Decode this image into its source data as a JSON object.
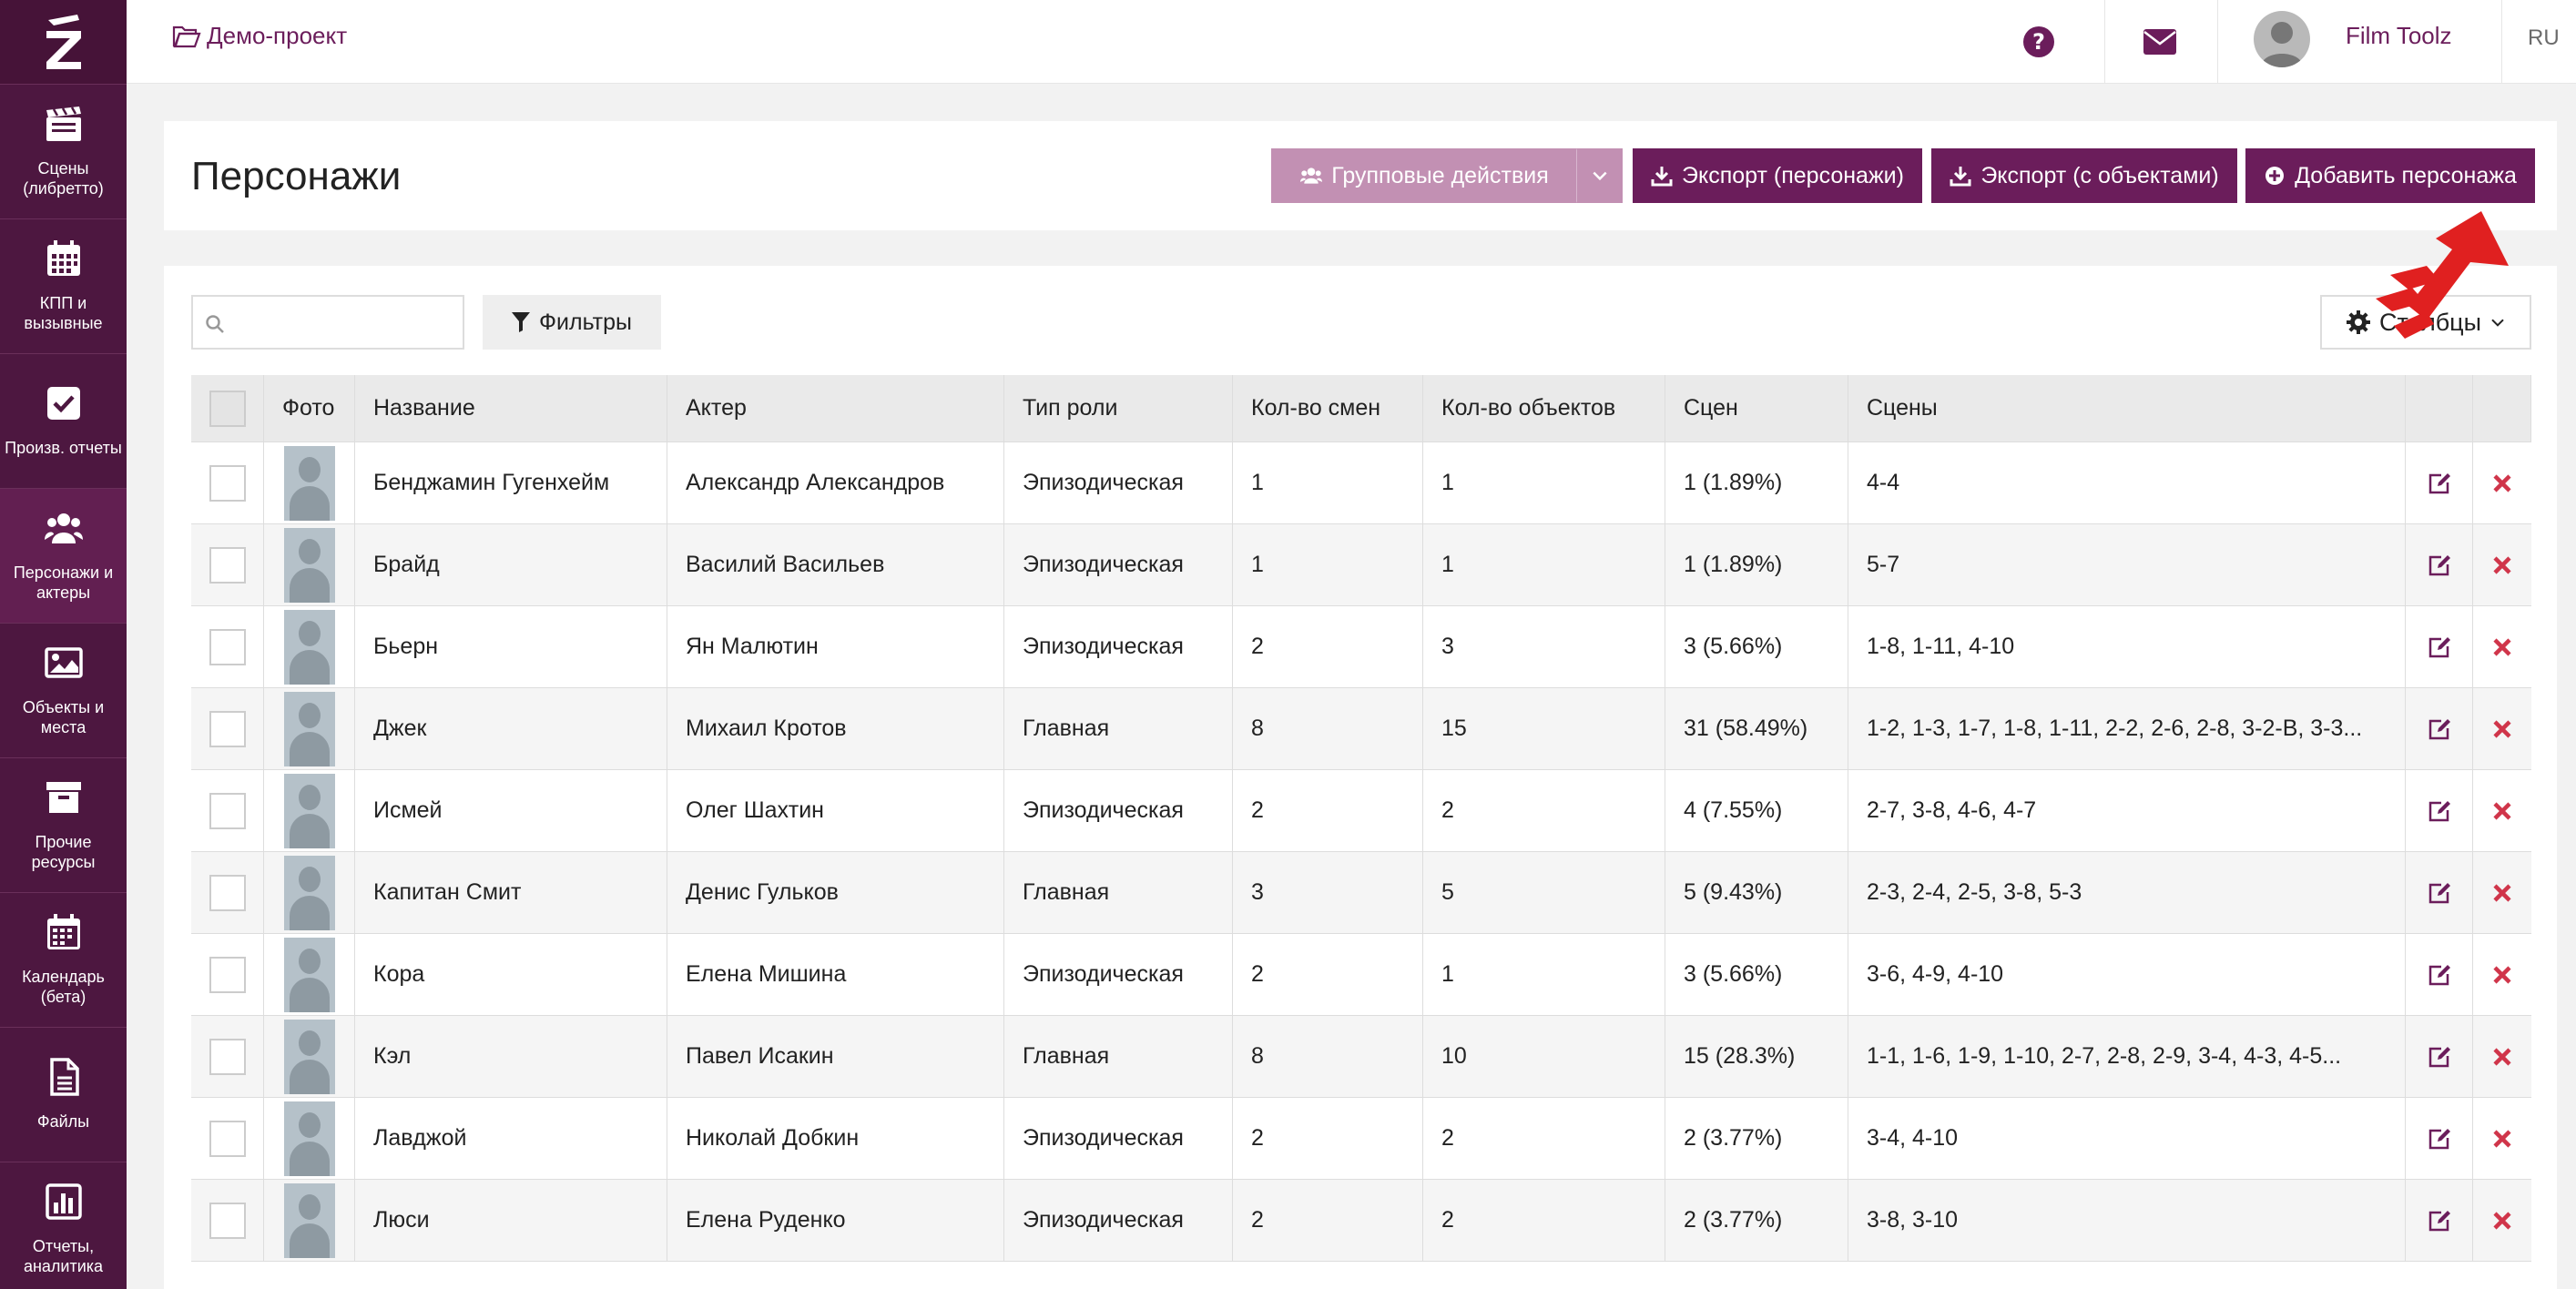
{
  "app": {
    "logo_letter": "Z"
  },
  "sidebar": {
    "items": [
      {
        "label": "Сцены\n(либретто)",
        "icon": "clapperboard-icon"
      },
      {
        "label": "КПП и\nвызывные",
        "icon": "calendar-grid-icon"
      },
      {
        "label": "Произв. отчеты",
        "icon": "check-square-icon"
      },
      {
        "label": "Персонажи и\nактеры",
        "icon": "users-icon"
      },
      {
        "label": "Объекты и\nместа",
        "icon": "image-icon"
      },
      {
        "label": "Прочие\nресурсы",
        "icon": "archive-icon"
      },
      {
        "label": "Календарь\n(бета)",
        "icon": "calendar-icon"
      },
      {
        "label": "Файлы",
        "icon": "file-icon"
      },
      {
        "label": "Отчеты,\nаналитика",
        "icon": "bar-chart-icon"
      }
    ]
  },
  "topbar": {
    "project": "Демо-проект",
    "user_name": "Film Toolz",
    "lang": "RU"
  },
  "header": {
    "title": "Персонажи",
    "group_actions": "Групповые действия",
    "export_characters": "Экспорт (персонажи)",
    "export_objects": "Экспорт (с объектами)",
    "add_character": "Добавить персонажа"
  },
  "toolbar": {
    "search_value": "",
    "filters": "Фильтры",
    "columns": "Столбцы"
  },
  "table": {
    "headers": [
      "Фото",
      "Название",
      "Актер",
      "Тип роли",
      "Кол-во смен",
      "Кол-во объектов",
      "Сцен",
      "Сцены"
    ],
    "rows": [
      {
        "name": "Бенджамин Гугенхейм",
        "actor": "Александр Александров",
        "role": "Эпизодическая",
        "shifts": "1",
        "objects": "1",
        "scene_count": "1 (1.89%)",
        "scenes": "4-4"
      },
      {
        "name": "Брайд",
        "actor": "Василий Васильев",
        "role": "Эпизодическая",
        "shifts": "1",
        "objects": "1",
        "scene_count": "1 (1.89%)",
        "scenes": "5-7"
      },
      {
        "name": "Бьерн",
        "actor": "Ян Малютин",
        "role": "Эпизодическая",
        "shifts": "2",
        "objects": "3",
        "scene_count": "3 (5.66%)",
        "scenes": "1-8, 1-11, 4-10"
      },
      {
        "name": "Джек",
        "actor": "Михаил Кротов",
        "role": "Главная",
        "shifts": "8",
        "objects": "15",
        "scene_count": "31 (58.49%)",
        "scenes": "1-2, 1-3, 1-7, 1-8, 1-11, 2-2, 2-6, 2-8, 3-2-В, 3-3..."
      },
      {
        "name": "Исмей",
        "actor": "Олег Шахтин",
        "role": "Эпизодическая",
        "shifts": "2",
        "objects": "2",
        "scene_count": "4 (7.55%)",
        "scenes": "2-7, 3-8, 4-6, 4-7"
      },
      {
        "name": "Капитан Смит",
        "actor": "Денис Гульков",
        "role": "Главная",
        "shifts": "3",
        "objects": "5",
        "scene_count": "5 (9.43%)",
        "scenes": "2-3, 2-4, 2-5, 3-8, 5-3"
      },
      {
        "name": "Кора",
        "actor": "Елена Мишина",
        "role": "Эпизодическая",
        "shifts": "2",
        "objects": "1",
        "scene_count": "3 (5.66%)",
        "scenes": "3-6, 4-9, 4-10"
      },
      {
        "name": "Кэл",
        "actor": "Павел Исакин",
        "role": "Главная",
        "shifts": "8",
        "objects": "10",
        "scene_count": "15 (28.3%)",
        "scenes": "1-1, 1-6, 1-9, 1-10, 2-7, 2-8, 2-9, 3-4, 4-3, 4-5..."
      },
      {
        "name": "Лавджой",
        "actor": "Николай Добкин",
        "role": "Эпизодическая",
        "shifts": "2",
        "objects": "2",
        "scene_count": "2 (3.77%)",
        "scenes": "3-4, 4-10"
      },
      {
        "name": "Люси",
        "actor": "Елена Руденко",
        "role": "Эпизодическая",
        "shifts": "2",
        "objects": "2",
        "scene_count": "2 (3.77%)",
        "scenes": "3-8, 3-10"
      }
    ]
  },
  "colors": {
    "brand": "#6b1d5b",
    "sidebar": "#4d1740",
    "delete": "#d0354a",
    "arrow": "#e02020"
  }
}
